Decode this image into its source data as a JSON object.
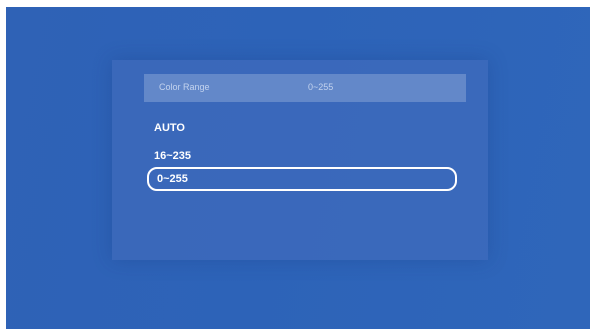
{
  "menu": {
    "header_label": "Color Range",
    "header_value": "0~255",
    "options": [
      {
        "label": "AUTO",
        "selected": false
      },
      {
        "label": "16~235",
        "selected": false
      },
      {
        "label": "0~255",
        "selected": true
      }
    ]
  },
  "colors": {
    "background": "#2f63b7",
    "selection_border": "#ffffff"
  }
}
